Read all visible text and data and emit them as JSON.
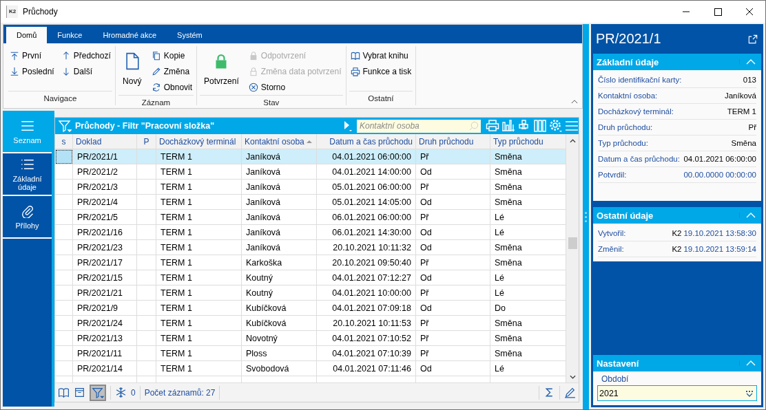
{
  "window": {
    "title": "Průchody",
    "app_icon_text": "K2"
  },
  "ribbon": {
    "tabs": [
      {
        "label": "Domů",
        "selected": true
      },
      {
        "label": "Funkce",
        "selected": false
      },
      {
        "label": "Hromadné akce",
        "selected": false
      },
      {
        "label": "Systém",
        "selected": false
      }
    ],
    "groups": [
      {
        "label": "Navigace",
        "columns": [
          [
            {
              "label": "První",
              "kind": "small",
              "disabled": false
            },
            {
              "label": "Poslední",
              "kind": "small",
              "disabled": false
            }
          ],
          [
            {
              "label": "Předchozí",
              "kind": "small",
              "disabled": false
            },
            {
              "label": "Další",
              "kind": "small",
              "disabled": false
            }
          ]
        ]
      },
      {
        "label": "Záznam",
        "columns": [
          [
            {
              "label": "Nový",
              "kind": "large",
              "disabled": false
            }
          ],
          [
            {
              "label": "Kopie",
              "kind": "small",
              "disabled": false
            },
            {
              "label": "Změna",
              "kind": "small",
              "disabled": false
            },
            {
              "label": "Obnovit",
              "kind": "small",
              "disabled": false
            }
          ]
        ]
      },
      {
        "label": "Stav",
        "columns": [
          [
            {
              "label": "Potvrzení",
              "kind": "large",
              "disabled": false
            }
          ],
          [
            {
              "label": "Odpotvrzení",
              "kind": "small",
              "disabled": true
            },
            {
              "label": "Změna data potvrzení",
              "kind": "small",
              "disabled": true
            },
            {
              "label": "Storno",
              "kind": "small",
              "disabled": false
            }
          ]
        ]
      },
      {
        "label": "Ostatní",
        "columns": [
          [
            {
              "label": "Vybrat knihu",
              "kind": "small",
              "disabled": false
            },
            {
              "label": "Funkce a tisk",
              "kind": "small",
              "disabled": false
            }
          ]
        ]
      }
    ]
  },
  "nav": [
    {
      "label": "Seznam",
      "selected": true
    },
    {
      "label": "Základní údaje",
      "selected": false
    },
    {
      "label": "Přílohy",
      "selected": false
    }
  ],
  "grid": {
    "title": "Průchody - Filtr \"Pracovní složka\"",
    "search": {
      "placeholder": "Kontaktní osoba"
    },
    "columns": [
      {
        "label": "s",
        "sorted": false
      },
      {
        "label": "Doklad",
        "sorted": false
      },
      {
        "label": "P",
        "sorted": false
      },
      {
        "label": "Docházkový terminál",
        "sorted": false
      },
      {
        "label": "Kontaktní osoba",
        "sorted": true
      },
      {
        "label": "Datum a čas průchodu",
        "sorted": false
      },
      {
        "label": "Druh průchodu",
        "sorted": false
      },
      {
        "label": "Typ průchodu",
        "sorted": false
      }
    ],
    "rows": [
      {
        "doklad": "PR/2021/1",
        "terminal": "TERM 1",
        "osoba": "Janíková",
        "datum": "04.01.2021 06:00:00",
        "druh": "Př",
        "typ": "Směna",
        "selected": true
      },
      {
        "doklad": "PR/2021/2",
        "terminal": "TERM 1",
        "osoba": "Janíková",
        "datum": "04.01.2021 14:00:00",
        "druh": "Od",
        "typ": "Směna",
        "selected": false
      },
      {
        "doklad": "PR/2021/3",
        "terminal": "TERM 1",
        "osoba": "Janíková",
        "datum": "05.01.2021 06:00:00",
        "druh": "Př",
        "typ": "Směna",
        "selected": false
      },
      {
        "doklad": "PR/2021/4",
        "terminal": "TERM 1",
        "osoba": "Janíková",
        "datum": "05.01.2021 14:05:00",
        "druh": "Od",
        "typ": "Směna",
        "selected": false
      },
      {
        "doklad": "PR/2021/5",
        "terminal": "TERM 1",
        "osoba": "Janíková",
        "datum": "06.01.2021 06:00:00",
        "druh": "Př",
        "typ": "Lé",
        "selected": false
      },
      {
        "doklad": "PR/2021/16",
        "terminal": "TERM 1",
        "osoba": "Janíková",
        "datum": "06.01.2021 14:30:00",
        "druh": "Od",
        "typ": "Lé",
        "selected": false
      },
      {
        "doklad": "PR/2021/23",
        "terminal": "TERM 1",
        "osoba": "Janíková",
        "datum": "20.10.2021 10:11:32",
        "druh": "Od",
        "typ": "Směna",
        "selected": false
      },
      {
        "doklad": "PR/2021/17",
        "terminal": "TERM 1",
        "osoba": "Karkoška",
        "datum": "20.10.2021 09:50:40",
        "druh": "Př",
        "typ": "Směna",
        "selected": false
      },
      {
        "doklad": "PR/2021/15",
        "terminal": "TERM 1",
        "osoba": "Koutný",
        "datum": "04.01.2021 07:12:27",
        "druh": "Od",
        "typ": "Lé",
        "selected": false
      },
      {
        "doklad": "PR/2021/21",
        "terminal": "TERM 1",
        "osoba": "Koutný",
        "datum": "04.01.2021 10:00:00",
        "druh": "Př",
        "typ": "Lé",
        "selected": false
      },
      {
        "doklad": "PR/2021/9",
        "terminal": "TERM 1",
        "osoba": "Kubíčková",
        "datum": "04.01.2021 07:09:18",
        "druh": "Od",
        "typ": "Do",
        "selected": false
      },
      {
        "doklad": "PR/2021/24",
        "terminal": "TERM 1",
        "osoba": "Kubíčková",
        "datum": "20.10.2021 10:11:53",
        "druh": "Př",
        "typ": "Směna",
        "selected": false
      },
      {
        "doklad": "PR/2021/13",
        "terminal": "TERM 1",
        "osoba": "Novotný",
        "datum": "04.01.2021 07:10:52",
        "druh": "Př",
        "typ": "Směna",
        "selected": false
      },
      {
        "doklad": "PR/2021/11",
        "terminal": "TERM 1",
        "osoba": "Ploss",
        "datum": "04.01.2021 07:10:39",
        "druh": "Př",
        "typ": "Směna",
        "selected": false
      },
      {
        "doklad": "PR/2021/14",
        "terminal": "TERM 1",
        "osoba": "Svobodová",
        "datum": "04.01.2021 07:11:46",
        "druh": "Od",
        "typ": "Lé",
        "selected": false
      }
    ],
    "footer": {
      "filter_active": true,
      "frozen_count": "0",
      "record_count": "Počet záznamů: 27"
    }
  },
  "detail": {
    "title": "PR/2021/1",
    "basic": {
      "title": "Základní údaje",
      "fields": [
        {
          "label": "Číslo identifikační karty:",
          "value": "013",
          "filled": true
        },
        {
          "label": "Kontaktní osoba:",
          "value": "Janíková",
          "filled": true
        },
        {
          "label": "Docházkový terminál:",
          "value": "TERM 1",
          "filled": true
        },
        {
          "label": "Druh průchodu:",
          "value": "Př",
          "filled": true
        },
        {
          "label": "Typ průchodu:",
          "value": "Směna",
          "filled": true
        },
        {
          "label": "Datum a čas průchodu:",
          "value": "04.01.2021 06:00:00",
          "filled": true
        },
        {
          "label": "Potvrdil:",
          "value": "00.00.0000 00:00:00",
          "filled": false
        }
      ]
    },
    "other": {
      "title": "Ostatní údaje",
      "fields": [
        {
          "label": "Vytvořil:",
          "user": "K2",
          "time": "19.10.2021 13:58:30"
        },
        {
          "label": "Změnil:",
          "user": "K2",
          "time": "19.10.2021 13:59:14"
        }
      ]
    },
    "settings": {
      "title": "Nastavení",
      "label": "Období",
      "value": "2021"
    }
  }
}
